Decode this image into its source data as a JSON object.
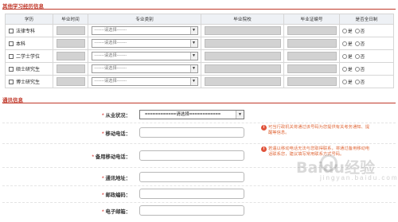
{
  "section_education": {
    "title": "其他学习经历信息",
    "headers": [
      "学历",
      "毕业时间",
      "专业类别",
      "毕业院校",
      "毕业证编号",
      "是否全日制"
    ],
    "rows": [
      {
        "label": "法律专科"
      },
      {
        "label": "本科"
      },
      {
        "label": "二学士学位"
      },
      {
        "label": "硕士研究生"
      },
      {
        "label": "博士研究生"
      }
    ],
    "select_placeholder": "-------请选择-------",
    "radio_yes": "是",
    "radio_no": "否"
  },
  "section_contact": {
    "title": "通讯信息",
    "required_mark": "*",
    "fields": {
      "employment_status": {
        "label": "从业状况：",
        "value": "============请选择============"
      },
      "mobile_phone": {
        "label": "移动电话："
      },
      "backup_mobile": {
        "label": "备用移动电话："
      },
      "address": {
        "label": "通讯地址："
      },
      "postal_code": {
        "label": "邮政编码："
      },
      "email": {
        "label": "电子邮箱："
      }
    },
    "hints": {
      "mobile_phone": "可当行政机关将通过该号码为您提供有关考务通知、提醒等信息。",
      "backup_mobile": "若遇以移动电话无法与您取得联系，将通过备用移动电话联系您，建议填写常用联系方式号码。"
    }
  },
  "watermark": {
    "brand": "Baidu经验",
    "sub": "jingyan.baidu.com"
  },
  "colors": {
    "accent": "#c0392b",
    "required": "#d9534f",
    "hint": "#e06a3b"
  },
  "icons": {
    "dropdown": "chevron-down-icon",
    "hint": "info-icon"
  }
}
